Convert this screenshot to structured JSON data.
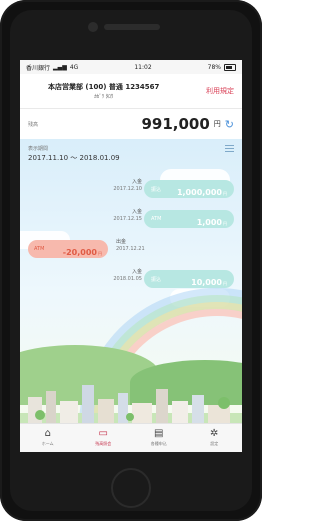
{
  "status": {
    "carrier": "香川銀行",
    "network": "4G",
    "time": "11:02",
    "battery": "78%"
  },
  "account": {
    "main": "本店営業部 (100)  普通 1234567",
    "sub": "ｶｶﾞﾜ ﾀﾛｳ",
    "terms": "利用規定"
  },
  "balance": {
    "label": "残高",
    "amount": "991,000",
    "unit": "円"
  },
  "history": {
    "period_label": "表示期間",
    "period_range": "2017.11.10 ～ 2018.01.09",
    "transactions": [
      {
        "direction": "入金",
        "date": "2017.12.10",
        "kind": "振込",
        "amount": "1,000,000",
        "unit": "円"
      },
      {
        "direction": "入金",
        "date": "2017.12.15",
        "kind": "ATM",
        "amount": "1,000",
        "unit": "円"
      },
      {
        "direction": "出金",
        "date": "2017.12.21",
        "kind": "ATM",
        "amount": "-20,000",
        "unit": "円"
      },
      {
        "direction": "入金",
        "date": "2018.01.05",
        "kind": "振込",
        "amount": "10,000",
        "unit": "円"
      }
    ]
  },
  "tabs": [
    {
      "label": "ホーム",
      "icon": "home-icon"
    },
    {
      "label": "残高照会",
      "icon": "card-icon"
    },
    {
      "label": "各種申込",
      "icon": "document-icon"
    },
    {
      "label": "設定",
      "icon": "gear-icon"
    }
  ],
  "colors": {
    "accent": "#c4304a",
    "deposit": "#b7e7e2",
    "withdrawal": "#f7b9ad",
    "refresh": "#4a90d9"
  }
}
